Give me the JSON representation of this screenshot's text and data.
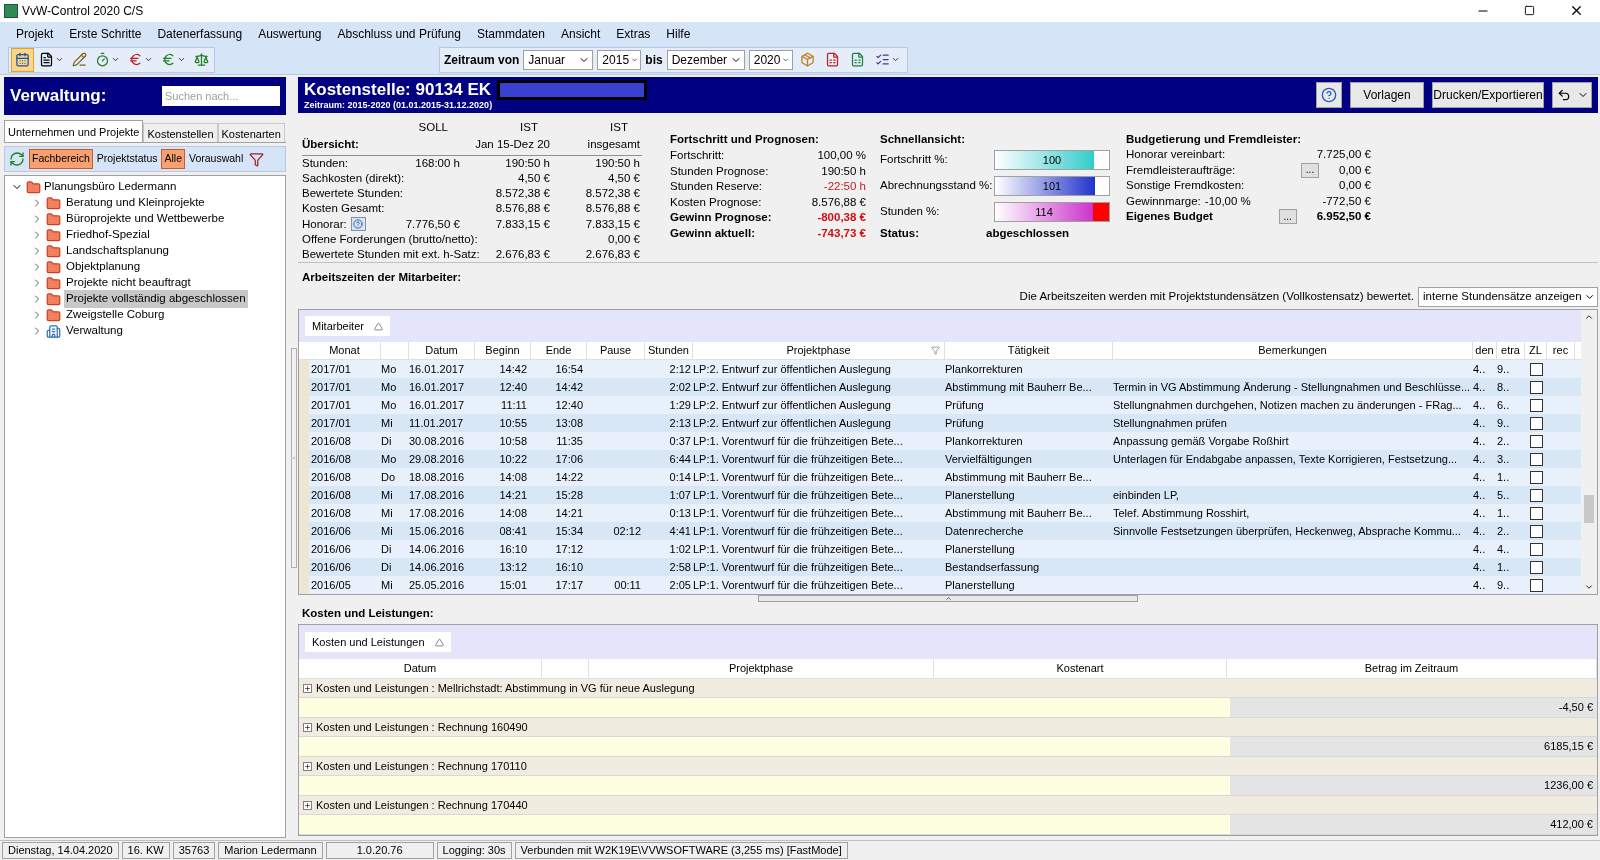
{
  "window": {
    "title": "VvW-Control 2020 C/S"
  },
  "menu": [
    "Projekt",
    "Erste Schritte",
    "Datenerfassung",
    "Auswertung",
    "Abschluss und Prüfung",
    "Stammdaten",
    "Ansicht",
    "Extras",
    "Hilfe"
  ],
  "period": {
    "label_from": "Zeitraum von",
    "month_from": "Januar",
    "year_from": "2015",
    "label_to": "bis",
    "month_to": "Dezember",
    "year_to": "2020"
  },
  "sidebar": {
    "title": "Verwaltung:",
    "search": {
      "placeholder": "Suchen nach..."
    },
    "tabs": [
      {
        "label": "Unternehmen und Projekte",
        "selected": true
      },
      {
        "label": "Kostenstellen",
        "selected": false
      },
      {
        "label": "Kostenarten",
        "selected": false
      }
    ],
    "filters": [
      {
        "label": "Fachbereich",
        "selected": true
      },
      {
        "label": "Projektstatus",
        "selected": false
      },
      {
        "label": "Alle",
        "selected": true
      },
      {
        "label": "Vorauswahl",
        "selected": false
      }
    ],
    "tree": {
      "label": "Planungsbüro Ledermann",
      "expanded": true,
      "children": [
        {
          "label": "Beratung und Kleinprojekte",
          "kind": "folder",
          "expanded": false,
          "selected": false
        },
        {
          "label": "Büroprojekte und Wettbewerbe",
          "kind": "folder",
          "expanded": false,
          "selected": false
        },
        {
          "label": "Friedhof-Spezial",
          "kind": "folder",
          "expanded": false,
          "selected": false
        },
        {
          "label": "Landschaftsplanung",
          "kind": "folder",
          "expanded": false,
          "selected": false
        },
        {
          "label": "Objektplanung",
          "kind": "folder",
          "expanded": false,
          "selected": false
        },
        {
          "label": "Projekte nicht beauftragt",
          "kind": "folder",
          "expanded": false,
          "selected": false
        },
        {
          "label": "Projekte vollständig abgeschlossen",
          "kind": "folder",
          "expanded": false,
          "selected": true
        },
        {
          "label": "Zweigstelle Coburg",
          "kind": "folder",
          "expanded": false,
          "selected": false
        },
        {
          "label": "Verwaltung",
          "kind": "admin",
          "expanded": false,
          "selected": false
        }
      ]
    }
  },
  "header": {
    "title": "Kostenstelle: 90134 EK",
    "subtitle": "Zeitraum: 2015-2020 (01.01.2015-31.12.2020)",
    "buttons": [
      "Vorlagen",
      "Drucken/Exportieren"
    ]
  },
  "overview": {
    "heading": "Übersicht:",
    "columns": [
      {
        "top": "SOLL"
      },
      {
        "top": "IST",
        "bottom": "Jan 15-Dez 20"
      },
      {
        "top": "IST",
        "bottom": "insgesamt"
      }
    ],
    "rows": [
      {
        "label": "Stunden:",
        "soll": "168:00 h",
        "ist": "190:50 h",
        "total": "190:50 h"
      },
      {
        "label": "Sachkosten (direkt):",
        "ist": "4,50 €",
        "total": "4,50 €"
      },
      {
        "label": "Bewertete Stunden:",
        "ist": "8.572,38 €",
        "total": "8.572,38 €"
      },
      {
        "label": "Kosten Gesamt:",
        "ist": "8.576,88 €",
        "total": "8.576,88 €"
      },
      {
        "label": "Honorar:",
        "help": true,
        "soll": "7.776,50 €",
        "ist": "7.833,15 €",
        "total": "7.833,15 €"
      },
      {
        "label": "Offene Forderungen (brutto/netto):",
        "total": "0,00 €"
      },
      {
        "label": "Bewertete Stunden mit ext. h-Satz:",
        "ist": "2.676,83 €",
        "total": "2.676,83 €"
      }
    ]
  },
  "forecast": {
    "heading": "Fortschritt und Prognosen:",
    "rows": [
      {
        "label": "Fortschritt:",
        "value": "100,00 %",
        "bold": false,
        "negative": false
      },
      {
        "label": "Stunden Prognose:",
        "value": "190:50 h",
        "bold": false,
        "negative": false
      },
      {
        "label": "Stunden Reserve:",
        "value": "-22:50 h",
        "bold": false,
        "negative": true
      },
      {
        "label": "Kosten Prognose:",
        "value": "8.576,88 €",
        "bold": false,
        "negative": false
      },
      {
        "label": "Gewinn Prognose:",
        "value": "-800,38 €",
        "bold": true,
        "negative": true
      },
      {
        "label": "Gewinn aktuell:",
        "value": "-743,73 €",
        "bold": true,
        "negative": true
      }
    ]
  },
  "quick": {
    "heading": "Schnellansicht:",
    "bars": [
      {
        "label": "Fortschritt %:",
        "value": "100",
        "level": 0.87,
        "over": false
      },
      {
        "label": "Abrechnungsstand %:",
        "value": "101",
        "level": 0.88,
        "over": false
      },
      {
        "label": "Stunden %:",
        "value": "114",
        "level": 0.86,
        "over": true
      }
    ],
    "status_label": "Status:",
    "status": "abgeschlossen"
  },
  "budget": {
    "heading": "Budgetierung und Fremdleister:",
    "rows": [
      {
        "label": "Honorar vereinbart:",
        "value": "7.725,00 €",
        "bold": false
      },
      {
        "label": "Fremdleisteraufträge:",
        "button": "...",
        "value": "0,00 €",
        "bold": false
      },
      {
        "label": "Sonstige Fremdkosten:",
        "value": "0,00 €",
        "bold": false
      },
      {
        "label": "Gewinnmarge:",
        "rate": "-10,00 %",
        "value": "-772,50 €",
        "bold": false
      },
      {
        "label": "Eigenes Budget",
        "button": "...",
        "value": "6.952,50 €",
        "bold": true
      }
    ]
  },
  "work": {
    "heading": "Arbeitszeiten der Mitarbeiter:",
    "note": "Die Arbeitszeiten werden mit Projektstundensätzen (Vollkostensatz) bewertet.",
    "rate_select": "interne Stundensätze anzeigen",
    "group_chip": "Mitarbeiter",
    "columns": [
      "Monat",
      "Datum",
      "Beginn",
      "Ende",
      "Pause",
      "Stunden",
      "Projektphase",
      "Tätigkeit",
      "Bemerkungen",
      "den",
      "etra",
      "ZL",
      "rec"
    ],
    "rows": [
      {
        "monat": "2017/01",
        "tag": "Mo",
        "datum": "16.01.2017",
        "beginn": "14:42",
        "ende": "16:54",
        "stunden": "2:12",
        "phase": "LP:2. Entwurf zur öffentlichen Auslegung",
        "taetigkeit": "Plankorrekturen",
        "c1": "4..",
        "c2": "9..",
        "zl": false
      },
      {
        "monat": "2017/01",
        "tag": "Mo",
        "datum": "16.01.2017",
        "beginn": "12:40",
        "ende": "14:42",
        "stunden": "2:02",
        "phase": "LP:2. Entwurf zur öffentlichen Auslegung",
        "taetigkeit": "Abstimmung mit Bauherr Be...",
        "bemerkung": "Termin in VG Abstimmung Änderung - Stellungnahmen und Beschlüsse...",
        "c1": "4..",
        "c2": "8..",
        "zl": false
      },
      {
        "monat": "2017/01",
        "tag": "Mo",
        "datum": "16.01.2017",
        "beginn": "11:11",
        "ende": "12:40",
        "stunden": "1:29",
        "phase": "LP:2. Entwurf zur öffentlichen Auslegung",
        "taetigkeit": "Prüfung",
        "bemerkung": "Stellungnahmen durchgehen, Notizen machen zu änderungen - FRag...",
        "c1": "4..",
        "c2": "6..",
        "zl": false
      },
      {
        "monat": "2017/01",
        "tag": "Mi",
        "datum": "11.01.2017",
        "beginn": "10:55",
        "ende": "13:08",
        "stunden": "2:13",
        "phase": "LP:2. Entwurf zur öffentlichen Auslegung",
        "taetigkeit": "Prüfung",
        "bemerkung": "Stellungnahmen prüfen",
        "c1": "4..",
        "c2": "9..",
        "zl": false
      },
      {
        "monat": "2016/08",
        "tag": "Di",
        "datum": "30.08.2016",
        "beginn": "10:58",
        "ende": "11:35",
        "stunden": "0:37",
        "phase": "LP:1. Vorentwurf für die frühzeitigen Bete...",
        "taetigkeit": "Plankorrekturen",
        "bemerkung": "Anpassung gemäß Vorgabe Roßhirt",
        "c1": "4..",
        "c2": "2..",
        "zl": false
      },
      {
        "monat": "2016/08",
        "tag": "Mo",
        "datum": "29.08.2016",
        "beginn": "10:22",
        "ende": "17:06",
        "stunden": "6:44",
        "phase": "LP:1. Vorentwurf für die frühzeitigen Bete...",
        "taetigkeit": "Vervielfältigungen",
        "bemerkung": "Unterlagen für Endabgabe anpassen, Texte Korrigieren, Festsetzung...",
        "c1": "4..",
        "c2": "3..",
        "zl": false
      },
      {
        "monat": "2016/08",
        "tag": "Do",
        "datum": "18.08.2016",
        "beginn": "14:08",
        "ende": "14:22",
        "stunden": "0:14",
        "phase": "LP:1. Vorentwurf für die frühzeitigen Bete...",
        "taetigkeit": "Abstimmung mit Bauherr Be...",
        "c1": "4..",
        "c2": "1..",
        "zl": false
      },
      {
        "monat": "2016/08",
        "tag": "Mi",
        "datum": "17.08.2016",
        "beginn": "14:21",
        "ende": "15:28",
        "stunden": "1:07",
        "phase": "LP:1. Vorentwurf für die frühzeitigen Bete...",
        "taetigkeit": "Planerstellung",
        "bemerkung": "einbinden LP,",
        "c1": "4..",
        "c2": "5..",
        "zl": false
      },
      {
        "monat": "2016/08",
        "tag": "Mi",
        "datum": "17.08.2016",
        "beginn": "14:08",
        "ende": "14:21",
        "stunden": "0:13",
        "phase": "LP:1. Vorentwurf für die frühzeitigen Bete...",
        "taetigkeit": "Abstimmung mit Bauherr Be...",
        "bemerkung": "Telef. Abstimmung Rosshirt,",
        "c1": "4..",
        "c2": "1..",
        "zl": false
      },
      {
        "monat": "2016/06",
        "tag": "Mi",
        "datum": "15.06.2016",
        "beginn": "08:41",
        "ende": "15:34",
        "pause": "02:12",
        "stunden": "4:41",
        "phase": "LP:1. Vorentwurf für die frühzeitigen Bete...",
        "taetigkeit": "Datenrecherche",
        "bemerkung": "Sinnvolle Festsetzungen überprüfen, Heckenweg, Absprache Kommu...",
        "c1": "4..",
        "c2": "2..",
        "zl": false
      },
      {
        "monat": "2016/06",
        "tag": "Di",
        "datum": "14.06.2016",
        "beginn": "16:10",
        "ende": "17:12",
        "stunden": "1:02",
        "phase": "LP:1. Vorentwurf für die frühzeitigen Bete...",
        "taetigkeit": "Planerstellung",
        "c1": "4..",
        "c2": "4..",
        "zl": false
      },
      {
        "monat": "2016/06",
        "tag": "Di",
        "datum": "14.06.2016",
        "beginn": "13:12",
        "ende": "16:10",
        "stunden": "2:58",
        "phase": "LP:1. Vorentwurf für die frühzeitigen Bete...",
        "taetigkeit": "Bestandserfassung",
        "c1": "4..",
        "c2": "1..",
        "zl": false
      },
      {
        "monat": "2016/05",
        "tag": "Mi",
        "datum": "25.05.2016",
        "beginn": "15:01",
        "ende": "17:17",
        "pause": "00:11",
        "stunden": "2:05",
        "phase": "LP:1. Vorentwurf für die frühzeitigen Bete...",
        "taetigkeit": "Planerstellung",
        "c1": "4..",
        "c2": "9..",
        "zl": false
      }
    ]
  },
  "costs": {
    "heading": "Kosten und Leistungen:",
    "group_chip": "Kosten und Leistungen",
    "columns": [
      "Datum",
      "Projektphase",
      "Kostenart",
      "Betrag im Zeitraum"
    ],
    "groups": [
      {
        "label": "Kosten und Leistungen : Mellrichstadt: Abstimmung in VG für neue Auslegung",
        "amount": "-4,50 €",
        "expanded": false
      },
      {
        "label": "Kosten und Leistungen : Rechnung 160490",
        "amount": "6185,15 €",
        "expanded": false
      },
      {
        "label": "Kosten und Leistungen : Rechnung 170110",
        "amount": "1236,00 €",
        "expanded": false
      },
      {
        "label": "Kosten und Leistungen : Rechnung 170440",
        "amount": "412,00 €",
        "expanded": false
      }
    ]
  },
  "status_bar": [
    "Dienstag, 14.04.2020",
    "16. KW",
    "35763",
    "Marion Ledermann",
    "1.0.20.76",
    "Logging: 30s",
    "Verbunden mit W2K19E\\VVWSOFTWARE (3,255 ms) [FastMode]"
  ]
}
